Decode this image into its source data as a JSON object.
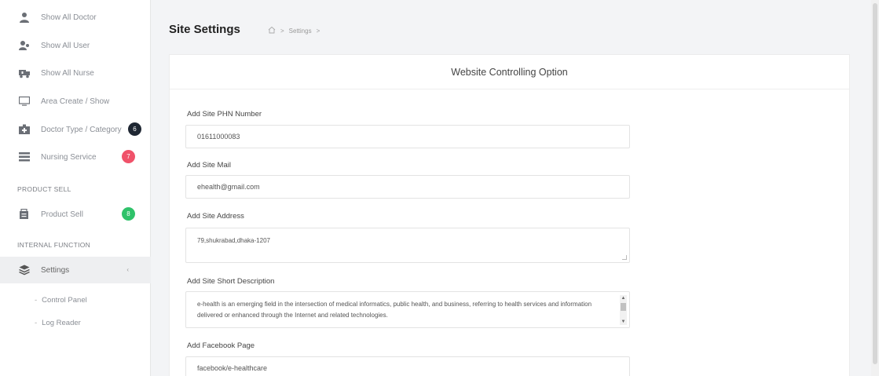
{
  "sidebar": {
    "items": [
      {
        "label": "Show All Doctor",
        "icon": "doctor-icon"
      },
      {
        "label": "Show All User",
        "icon": "users-icon"
      },
      {
        "label": "Show All Nurse",
        "icon": "ambulance-icon"
      },
      {
        "label": "Area Create / Show",
        "icon": "monitor-icon"
      },
      {
        "label": "Doctor Type / Category",
        "icon": "hospital-icon",
        "badge": "6",
        "badge_color": "#1f2733"
      },
      {
        "label": "Nursing Service",
        "icon": "list-icon",
        "badge": "7",
        "badge_color": "#f0526a"
      }
    ],
    "section_product": "PRODUCT SELL",
    "product_item": {
      "label": "Product Sell",
      "icon": "cart-icon",
      "badge": "8",
      "badge_color": "#2fc26a"
    },
    "section_internal": "INTERNAL FUNCTION",
    "settings_item": {
      "label": "Settings",
      "icon": "layers-icon",
      "caret": "‹"
    },
    "sub_items": [
      {
        "label": "Control Panel"
      },
      {
        "label": "Log Reader"
      }
    ]
  },
  "header": {
    "title": "Site Settings",
    "breadcrumb": "Settings",
    "separator": ">"
  },
  "card": {
    "title": "Website Controlling Option"
  },
  "form": {
    "phone_label": "Add Site PHN Number",
    "phone_value": "01611000083",
    "mail_label": "Add Site Mail",
    "mail_value": "ehealth@gmail.com",
    "address_label": "Add Site Address",
    "address_value": "79,shukrabad,dhaka-1207",
    "desc_label": "Add Site Short Description",
    "desc_value": "e-health is an emerging field in the intersection of medical informatics, public health, and business, referring to health services and information delivered or enhanced through the Internet and related technologies.",
    "facebook_label": "Add Facebook Page",
    "facebook_value": "facebook/e-healthcare"
  }
}
